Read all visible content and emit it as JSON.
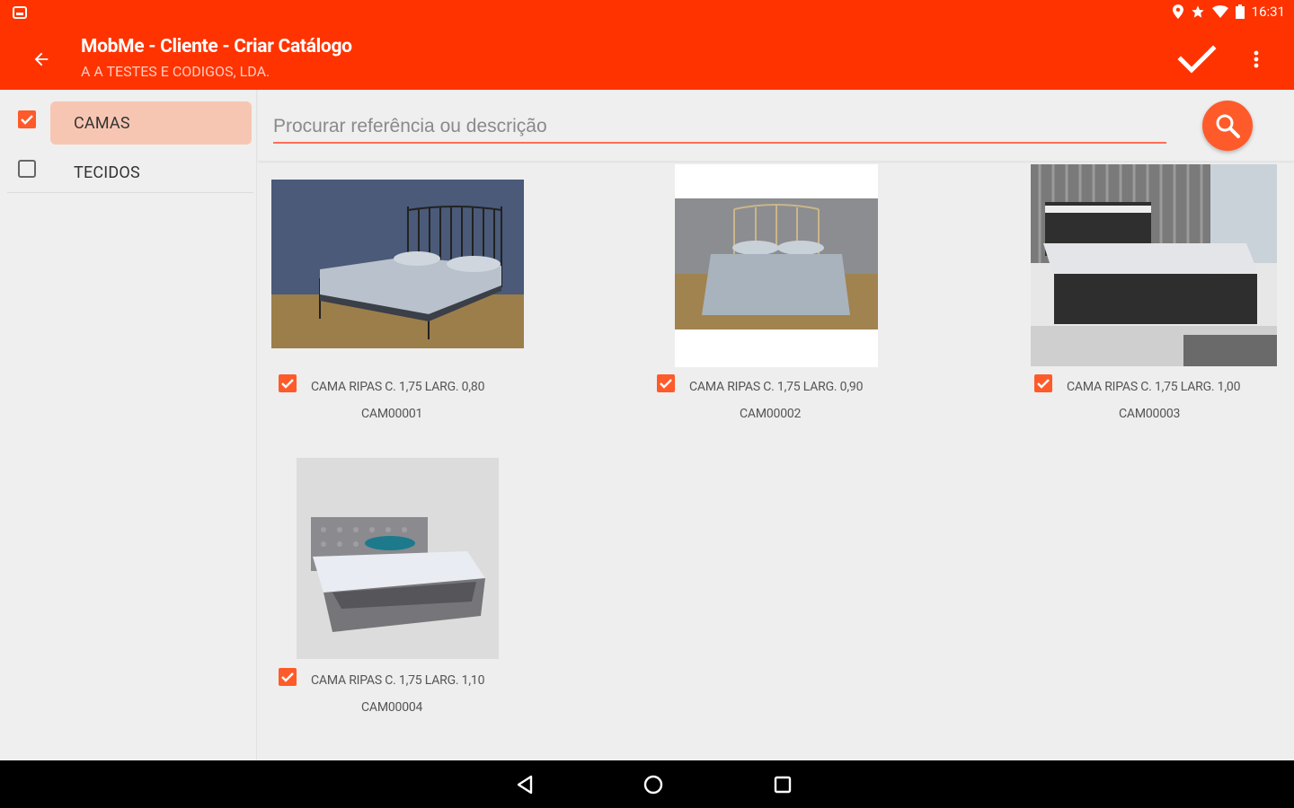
{
  "status_bar": {
    "time": "16:31",
    "icons": [
      "screenshot-icon",
      "location-icon",
      "star-icon",
      "wifi-icon",
      "battery-icon"
    ]
  },
  "app_bar": {
    "title": "MobMe - Cliente - Criar Catálogo",
    "subtitle": "A A TESTES E CODIGOS, LDA.",
    "color": "#ff3300"
  },
  "categories": [
    {
      "label": "CAMAS",
      "checked": true
    },
    {
      "label": "TECIDOS",
      "checked": false
    }
  ],
  "search": {
    "placeholder": "Procurar referência ou descrição"
  },
  "products": [
    {
      "name": "CAMA RIPAS C. 1,75 LARG. 0,80",
      "code": "CAM00001",
      "checked": true
    },
    {
      "name": "CAMA RIPAS C. 1,75 LARG. 0,90",
      "code": "CAM00002",
      "checked": true
    },
    {
      "name": "CAMA RIPAS C. 1,75 LARG. 1,00",
      "code": "CAM00003",
      "checked": true
    },
    {
      "name": "CAMA RIPAS C. 1,75 LARG. 1,10",
      "code": "CAM00004",
      "checked": true
    }
  ],
  "accent_color": "#ff5a2a"
}
